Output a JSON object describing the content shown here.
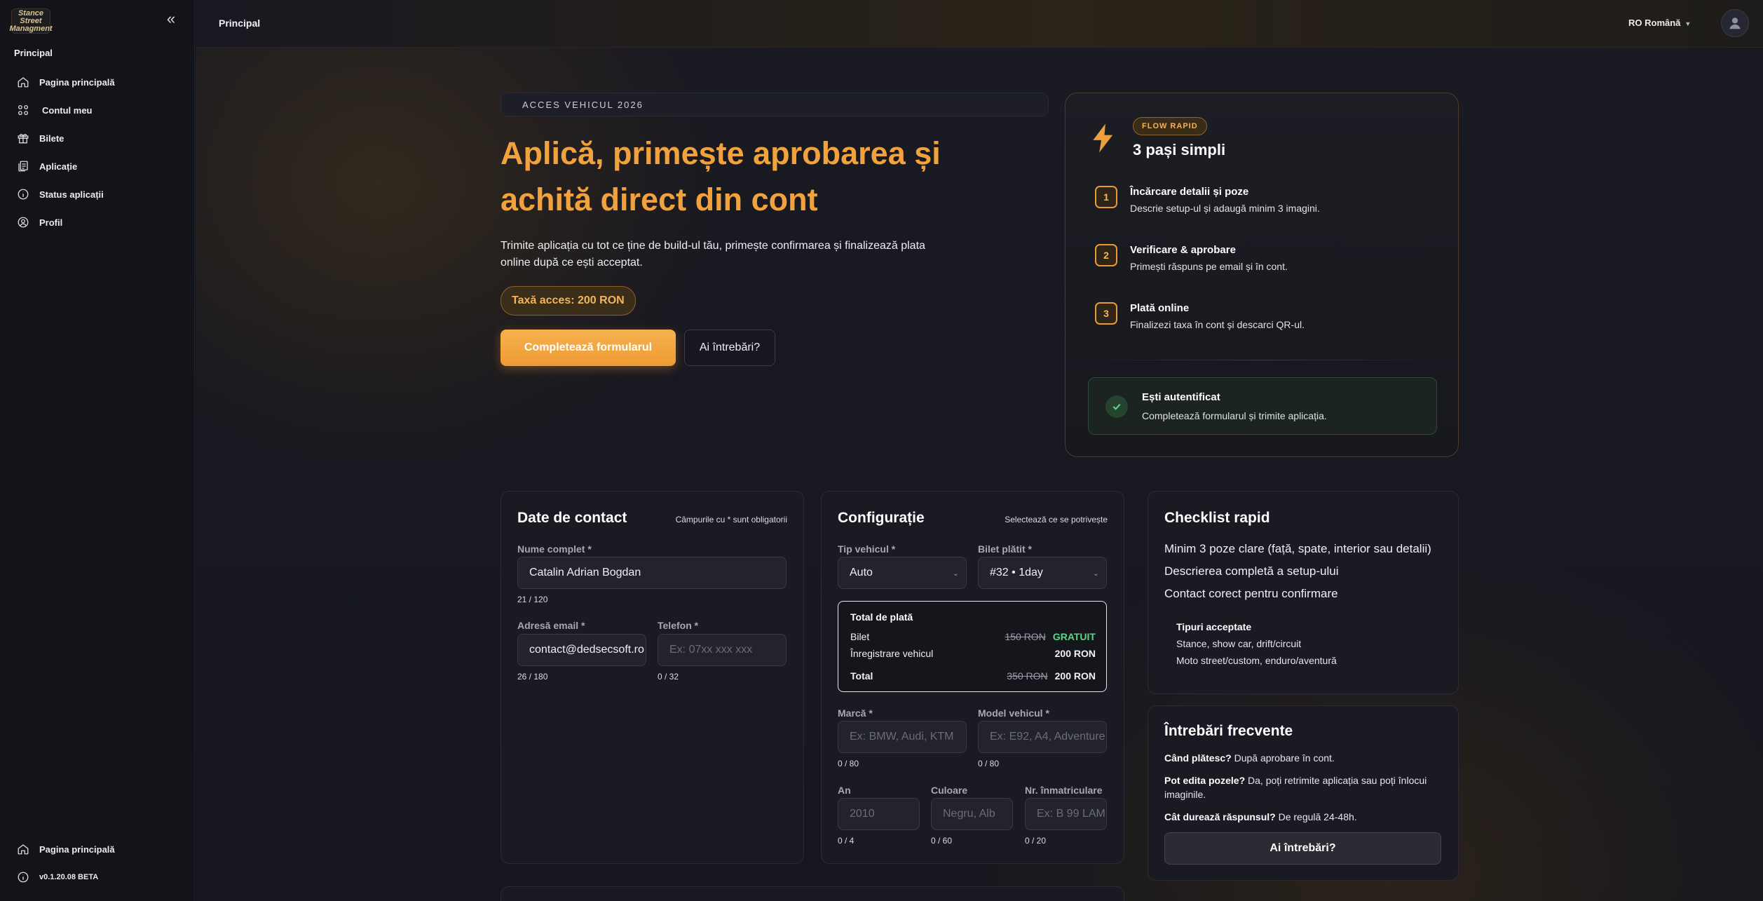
{
  "sidebar": {
    "logo_text": "Stance Street Managment",
    "section_title": "Principal",
    "items": [
      {
        "label": "Pagina principală",
        "icon": "home-icon"
      },
      {
        "label": "Contul meu",
        "icon": "grid-icon"
      },
      {
        "label": "Bilete",
        "icon": "gift-icon"
      },
      {
        "label": "Aplicație",
        "icon": "clipboard-icon"
      },
      {
        "label": "Status aplicații",
        "icon": "info-icon"
      },
      {
        "label": "Profil",
        "icon": "user-circle-icon"
      }
    ],
    "bottom": {
      "home_label": "Pagina principală",
      "version": "v0.1.20.08 BETA"
    }
  },
  "topbar": {
    "title": "Principal",
    "language": "RO Română"
  },
  "hero": {
    "eyebrow": "ACCES VEHICUL 2026",
    "title": "Aplică, primește aprobarea și achită direct din cont",
    "description": "Trimite aplicația cu tot ce ține de build-ul tău, primește confirmarea și finalizează plata online după ce ești acceptat.",
    "fee_badge": "Taxă acces: 200 RON",
    "primary_button": "Completează formularul",
    "secondary_button": "Ai întrebări?"
  },
  "steps": {
    "badge": "FLOW RAPID",
    "title": "3 pași simpli",
    "items": [
      {
        "num": "1",
        "title": "Încărcare detalii și poze",
        "desc": "Descrie setup-ul și adaugă minim 3 imagini."
      },
      {
        "num": "2",
        "title": "Verificare & aprobare",
        "desc": "Primești răspuns pe email și în cont."
      },
      {
        "num": "3",
        "title": "Plată online",
        "desc": "Finalizezi taxa în cont și descarci QR-ul."
      }
    ],
    "auth": {
      "title": "Ești autentificat",
      "desc": "Completează formularul și trimite aplicația."
    }
  },
  "contact": {
    "title": "Date de contact",
    "note": "Câmpurile cu * sunt obligatorii",
    "name_label": "Nume complet *",
    "name_value": "Catalin Adrian Bogdan",
    "name_counter": "21 / 120",
    "email_label": "Adresă email *",
    "email_value": "contact@dedsecsoft.ro",
    "email_counter": "26 / 180",
    "phone_label": "Telefon *",
    "phone_placeholder": "Ex: 07xx xxx xxx",
    "phone_counter": "0 / 32"
  },
  "config": {
    "title": "Configurație",
    "note": "Selectează ce se potrivește",
    "vehicle_type_label": "Tip vehicul *",
    "vehicle_type_value": "Auto",
    "ticket_label": "Bilet plătit *",
    "ticket_value": "#32 • 1day",
    "total": {
      "title": "Total de plată",
      "ticket_label": "Bilet",
      "ticket_old": "150 RON",
      "ticket_new": "GRATUIT",
      "reg_label": "Înregistrare vehicul",
      "reg_value": "200 RON",
      "total_label": "Total",
      "total_old": "350 RON",
      "total_new": "200 RON"
    },
    "brand_label": "Marcă *",
    "brand_placeholder": "Ex: BMW, Audi, KTM",
    "brand_counter": "0 / 80",
    "model_label": "Model vehicul *",
    "model_placeholder": "Ex: E92, A4, Adventure",
    "model_counter": "0 / 80",
    "year_label": "An",
    "year_placeholder": "2010",
    "year_counter": "0 / 4",
    "color_label": "Culoare",
    "color_placeholder": "Negru, Alb",
    "color_counter": "0 / 60",
    "plate_label": "Nr. înmatriculare",
    "plate_placeholder": "Ex: B 99 LAM",
    "plate_counter": "0 / 20"
  },
  "checklist": {
    "title": "Checklist rapid",
    "items": [
      "Minim 3 poze clare (față, spate, interior sau detalii)",
      "Descrierea completă a setup-ului",
      "Contact corect pentru confirmare"
    ],
    "types_title": "Tipuri acceptate",
    "types": [
      "Stance, show car, drift/circuit",
      "Moto street/custom, enduro/aventură"
    ]
  },
  "faq": {
    "title": "Întrebări frecvente",
    "items": [
      {
        "q": "Când plătesc?",
        "a": "După aprobare în cont."
      },
      {
        "q": "Pot edita pozele?",
        "a": "Da, poți retrimite aplicația sau poți înlocui imaginile."
      },
      {
        "q": "Cât durează răspunsul?",
        "a": "De regulă 24-48h."
      }
    ],
    "button": "Ai întrebări?"
  }
}
